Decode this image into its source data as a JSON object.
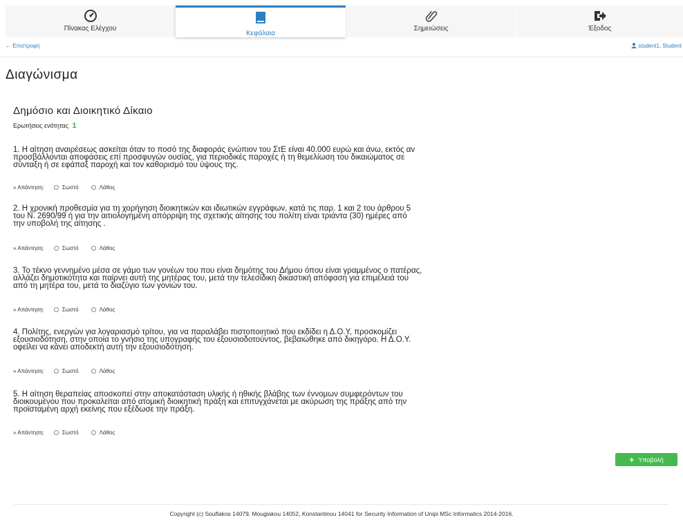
{
  "nav": {
    "tabs": [
      {
        "label": "Πίνακας Ελέγχου",
        "icon": "dashboard-gauge-icon"
      },
      {
        "label": "Κεφάλαια",
        "icon": "book-icon",
        "active": true
      },
      {
        "label": "Σημειώσεις",
        "icon": "paperclip-icon"
      },
      {
        "label": "Έξοδος",
        "icon": "sign-out-icon"
      }
    ]
  },
  "subbar": {
    "back_label": "← Επιστροφή",
    "user_label": "student1, Student"
  },
  "page_title": "Διαγώνισμα",
  "section": {
    "title": "Δημόσιο και Διοικητικό Δίκαιο",
    "count_label": "Ερωτήσεις ενότητας",
    "count_value": "1"
  },
  "questions": [
    {
      "lines": [
        "1. Η αίτηση αναιρέσεως ασκείται όταν το ποσό της διαφοράς ενώπιον του ΣτΕ είναι 40.000 ευρώ και άνω, εκτός αν",
        "προσβάλλονται αποφάσεις επί προσφυγών ουσίας, για περιοδικές παροχές ή τη θεμελίωση του δικαιώματος σε",
        "σύνταξη ή σε εφάπαξ παροχή και τον καθορισμό του ύψους της."
      ]
    },
    {
      "lines": [
        "2. Η χρονική προθεσμία για τη χορήγηση διοικητικών και ιδιωτικών εγγράφων, κατά τις παρ. 1 και 2 του άρθρου 5",
        "του Ν. 2690/99 ή για την αιτιολογημένη απόρριψη της σχετικής αίτησης του πολίτη είναι τριάντα (30) ημέρες από",
        "την υποβολή της αίτησης ."
      ]
    },
    {
      "lines": [
        "3. Το τέκνο γεννημένο μέσα σε γάμο των γονέων του που είναι δημότης του Δήμου όπου είναι γραμμένος ο πατέρας,",
        "αλλάζει δημοτικότητα και παίρνει αυτή της μητέρας του, μετά την τελεσίδικη δικαστική απόφαση για επιμέλειά του",
        "από τη μητέρα του, μετά το διαζύγιο των γονιών του."
      ]
    },
    {
      "lines": [
        "4. Πολίτης, ενεργών για λογαριασμό τρίτου, για να παραλάβει πιστοποιητικό που εκδίδει η Δ.Ο.Υ, προσκομίζει",
        "εξουσιοδότηση, στην οποία το γνήσιο της υπογραφής του εξουσιοδοτούντος, βεβαιώθηκε από δικηγόρο. Η Δ.Ο.Υ.",
        "οφείλει να κάνει αποδεκτή αυτή την εξουσιοδότηση."
      ]
    },
    {
      "lines": [
        "5. Η αίτηση θεραπείας αποσκοπεί στην αποκατάσταση υλικής ή ηθικής βλάβης των έννομων συμφερόντων του",
        "διοικουμένου που προκαλείται από ατομική διοικητική πράξη και επιτυγχάνεται με ακύρωση της πράξης από την",
        "προϊσταμένη αρχή εκείνης που εξέδωσε την πράξη."
      ]
    }
  ],
  "answer": {
    "label": "» Απάντηση:",
    "true_label": "Σωστό",
    "false_label": "Λάθος"
  },
  "submit_label": "Υποβολή",
  "footer": "Copyright (c) Souflakos 14079, Mougiakou 14052, Konstantinou 14041 for Security Information of Unipi MSc Informatics 2014-2016."
}
